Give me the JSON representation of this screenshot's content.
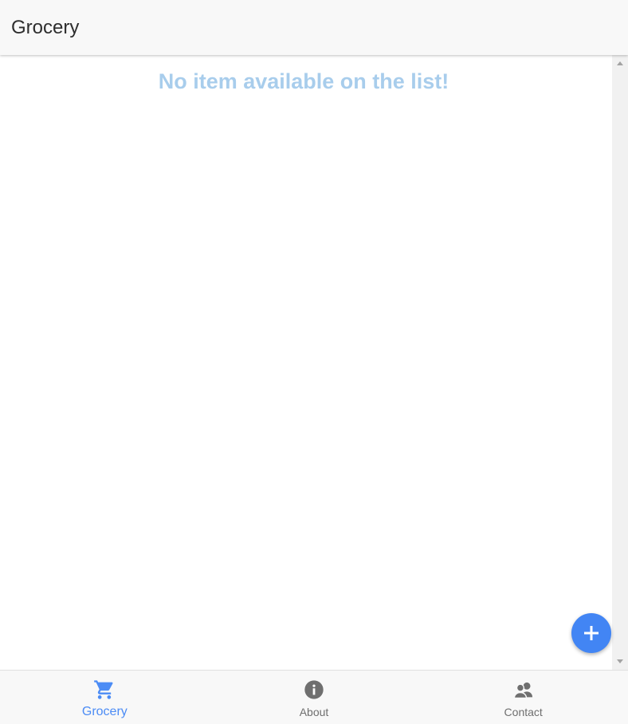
{
  "app_bar": {
    "title": "Grocery"
  },
  "content": {
    "empty_message": "No item available on the list!"
  },
  "fab": {
    "icon": "plus-icon"
  },
  "bottom_nav": {
    "items": [
      {
        "label": "Grocery",
        "icon": "cart-icon",
        "active": true
      },
      {
        "label": "About",
        "icon": "info-icon",
        "active": false
      },
      {
        "label": "Contact",
        "icon": "people-icon",
        "active": false
      }
    ]
  },
  "colors": {
    "accent": "#4285f4",
    "active_nav": "#4c8cf5",
    "empty_message": "#a8cdec",
    "inactive_icon": "#6f6f6f"
  }
}
